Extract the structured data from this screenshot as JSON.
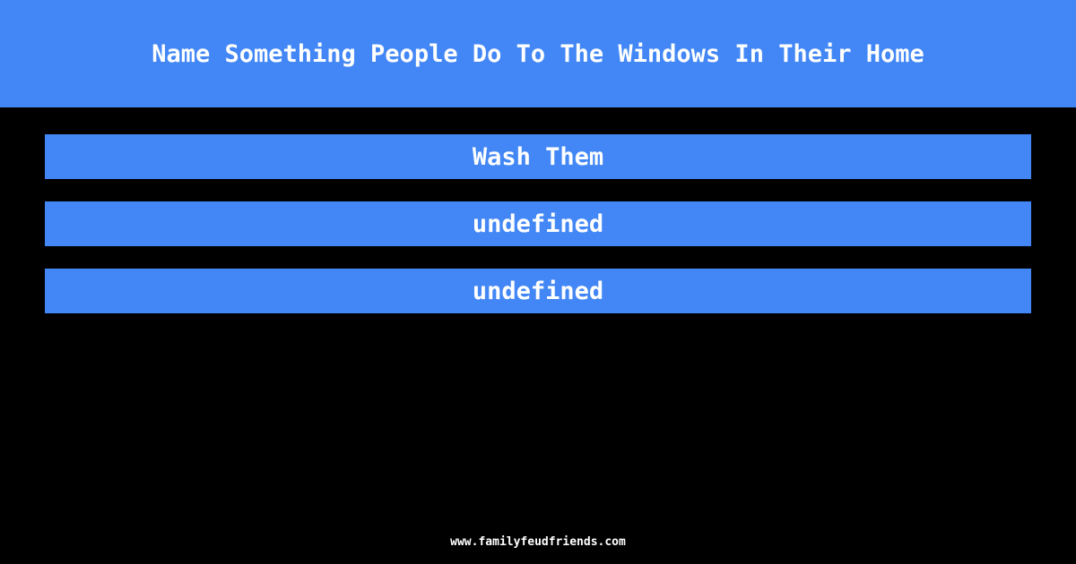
{
  "header": {
    "title": "Name Something People Do To The Windows In Their Home"
  },
  "answers": [
    {
      "label": "Wash Them"
    },
    {
      "label": "undefined"
    },
    {
      "label": "undefined"
    }
  ],
  "footer": {
    "site": "www.familyfeudfriends.com"
  },
  "colors": {
    "accent": "#4287f5",
    "background": "#000000",
    "text": "#ffffff"
  }
}
